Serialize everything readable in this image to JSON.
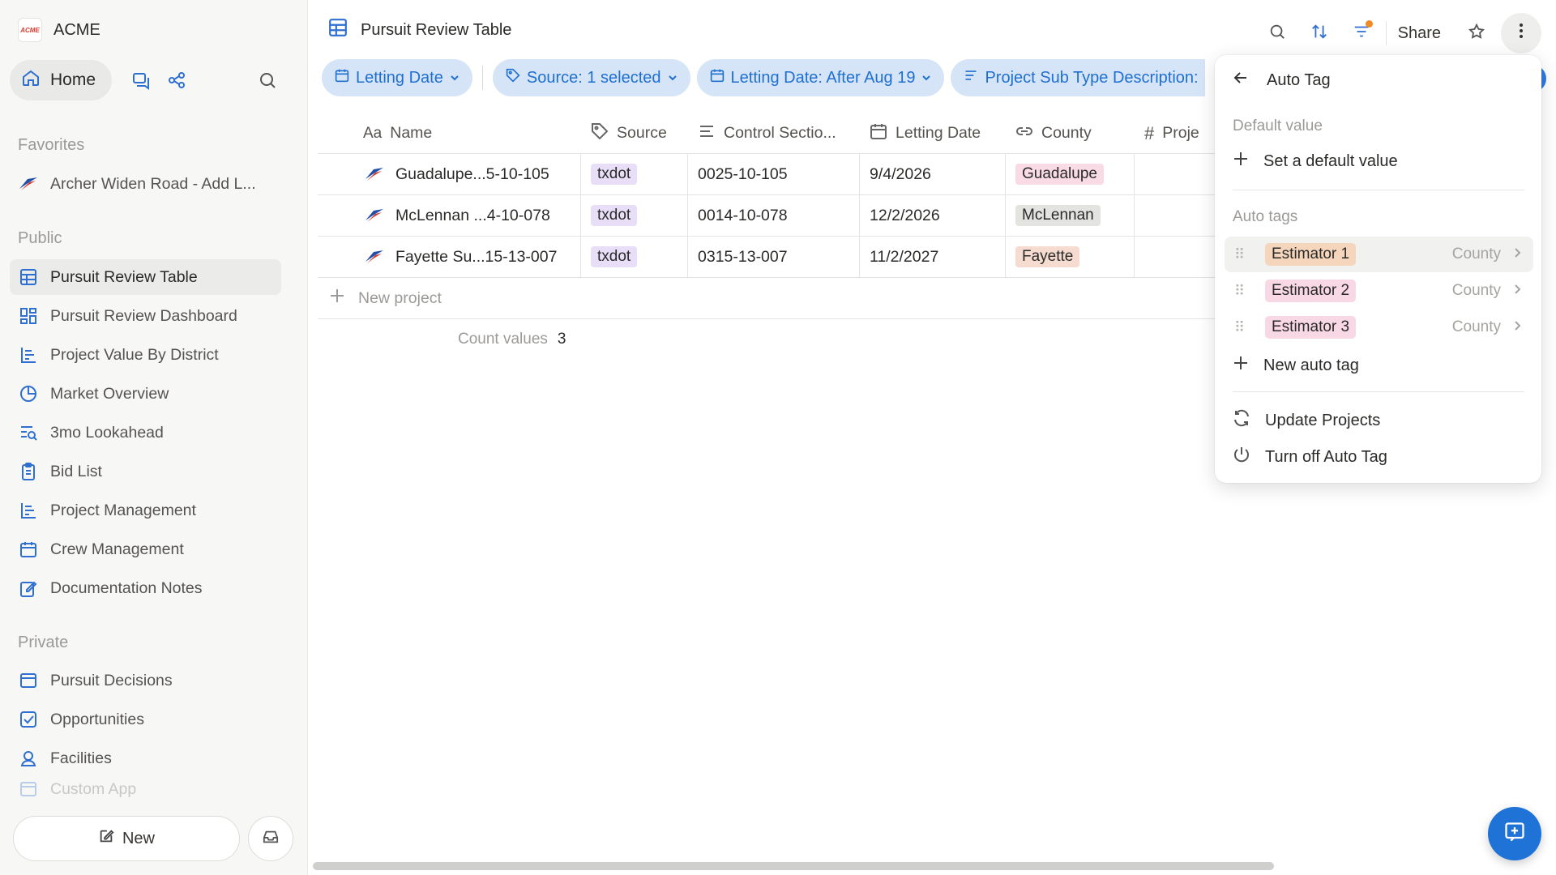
{
  "workspace": {
    "name": "ACME",
    "logo_text": "ACME"
  },
  "nav": {
    "home_label": "Home"
  },
  "sidebar": {
    "favorites_label": "Favorites",
    "favorites": [
      {
        "label": "Archer Widen Road - Add L..."
      }
    ],
    "public_label": "Public",
    "public_items": [
      {
        "label": "Pursuit Review Table",
        "icon": "table-icon"
      },
      {
        "label": "Pursuit Review Dashboard",
        "icon": "dashboard-icon"
      },
      {
        "label": "Project Value By District",
        "icon": "bar-chart-icon"
      },
      {
        "label": "Market Overview",
        "icon": "pie-chart-icon"
      },
      {
        "label": "3mo Lookahead",
        "icon": "list-search-icon"
      },
      {
        "label": "Bid List",
        "icon": "clipboard-icon"
      },
      {
        "label": "Project Management",
        "icon": "bar-chart-icon"
      },
      {
        "label": "Crew Management",
        "icon": "calendar-icon"
      },
      {
        "label": "Documentation Notes",
        "icon": "note-edit-icon"
      }
    ],
    "private_label": "Private",
    "private_items": [
      {
        "label": "Pursuit Decisions",
        "icon": "board-icon"
      },
      {
        "label": "Opportunities",
        "icon": "checkbox-icon"
      },
      {
        "label": "Facilities",
        "icon": "person-pin-icon"
      },
      {
        "label": "Custom App",
        "icon": "board-icon"
      }
    ],
    "new_label": "New"
  },
  "header": {
    "title": "Pursuit Review Table",
    "share_label": "Share"
  },
  "filters": [
    {
      "label": "Letting Date",
      "icon": "calendar-icon"
    },
    {
      "label": "Source: 1 selected",
      "icon": "tag-icon"
    },
    {
      "label": "Letting Date: After Aug 19",
      "icon": "calendar-icon"
    },
    {
      "label": "Project Sub Type Description:",
      "icon": "lines-icon"
    }
  ],
  "table": {
    "columns": [
      {
        "label": "Name",
        "icon": "Aa"
      },
      {
        "label": "Source",
        "icon": "tag-icon"
      },
      {
        "label": "Control Sectio...",
        "icon": "lines-icon"
      },
      {
        "label": "Letting Date",
        "icon": "calendar-icon"
      },
      {
        "label": "County",
        "icon": "link-icon"
      },
      {
        "label": "Proje",
        "icon": "#"
      }
    ],
    "rows": [
      {
        "name": "Guadalupe...5-10-105",
        "source": "txdot",
        "control": "0025-10-105",
        "letting": "9/4/2026",
        "county": "Guadalupe",
        "county_color": "#f9dbe5"
      },
      {
        "name": "McLennan ...4-10-078",
        "source": "txdot",
        "control": "0014-10-078",
        "letting": "12/2/2026",
        "county": "McLennan",
        "county_color": "#e3e3e0"
      },
      {
        "name": "Fayette Su...15-13-007",
        "source": "txdot",
        "control": "0315-13-007",
        "letting": "11/2/2027",
        "county": "Fayette",
        "county_color": "#f6dcd0"
      }
    ],
    "new_row_label": "New project",
    "count_label": "Count values",
    "count_value": "3"
  },
  "panel": {
    "title": "Auto Tag",
    "default_section": "Default value",
    "set_default": "Set a default value",
    "auto_section": "Auto tags",
    "auto_tags": [
      {
        "label": "Estimator 1",
        "field": "County",
        "color": "#f6d5bd"
      },
      {
        "label": "Estimator 2",
        "field": "County",
        "color": "#f9d8e6"
      },
      {
        "label": "Estimator 3",
        "field": "County",
        "color": "#f9d8e6"
      }
    ],
    "new_auto_tag": "New auto tag",
    "update_projects": "Update Projects",
    "turn_off": "Turn off Auto Tag"
  },
  "colors": {
    "accent": "#1f73d6",
    "chip_bg": "#d5e5f7",
    "notification_dot": "#f08a24"
  }
}
